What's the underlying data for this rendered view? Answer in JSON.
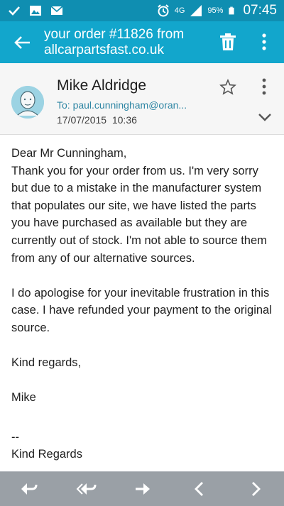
{
  "status_bar": {
    "network": "4G",
    "battery": "95%",
    "time": "07:45"
  },
  "app_bar": {
    "subject": "your order #11826 from allcarpartsfast.co.uk"
  },
  "header": {
    "sender": "Mike Aldridge",
    "to": "To: paul.cunningham@oran...",
    "date": "17/07/2015",
    "time": "10:36"
  },
  "body": {
    "greeting": "Dear Mr Cunningham,",
    "paragraph1": "Thank you for your order from us. I'm very sorry but due to a mistake in the manufacturer system that populates our site, we have listed the parts you have purchased as available but they are currently out of stock. I'm not able to source them from any of our alternative sources.",
    "paragraph2": "I do apologise for your inevitable frustration in this case. I have refunded your payment to the original source.",
    "closing": "Kind regards,",
    "name": "Mike",
    "sig_separator": "--",
    "sig_text": "Kind Regards"
  },
  "colors": {
    "status_bar": "#0f8eb1",
    "app_bar": "#12a6cc",
    "header_bg": "#f6f6f6",
    "bottom_bar": "#9aa0a6"
  },
  "icons": {
    "status_left": [
      "check-icon",
      "image-icon",
      "mail-icon"
    ],
    "status_right": [
      "alarm-icon",
      "signal-icon",
      "battery-icon"
    ],
    "app_bar": [
      "back-arrow-icon",
      "trash-icon",
      "overflow-menu-icon"
    ],
    "header": [
      "avatar-icon",
      "star-icon",
      "overflow-menu-icon",
      "chevron-down-icon"
    ],
    "bottom_bar": [
      "reply-icon",
      "reply-all-icon",
      "forward-icon",
      "previous-icon",
      "next-icon"
    ]
  }
}
